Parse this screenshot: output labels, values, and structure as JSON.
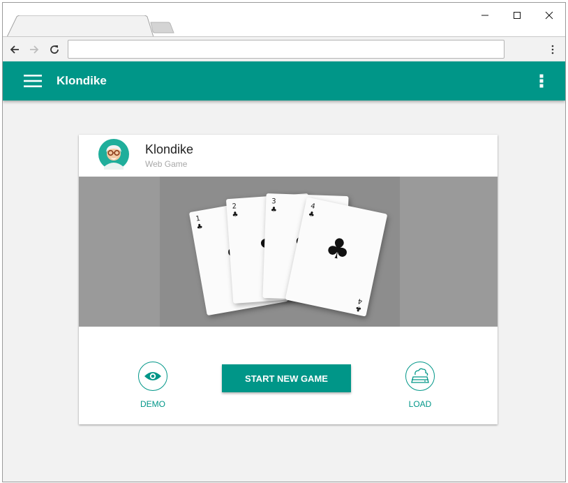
{
  "browser": {
    "tab_title": "",
    "address": "",
    "window_controls": {
      "minimize": "minimize-icon",
      "maximize": "maximize-icon",
      "close": "close-icon"
    },
    "nav_icons": {
      "back": "back-arrow-icon",
      "forward": "forward-arrow-icon",
      "reload": "reload-icon",
      "menu": "more-vert-icon"
    }
  },
  "appbar": {
    "title": "Klondike",
    "color": "#009688",
    "menu_icon": "hamburger-menu-icon",
    "more_icon": "more-vert-icon"
  },
  "card": {
    "title": "Klondike",
    "subtitle": "Web Game",
    "avatar": "avatar-old-man-glasses",
    "media": {
      "cards": [
        {
          "rank": "1",
          "suit": "♣"
        },
        {
          "rank": "2",
          "suit": "♣"
        },
        {
          "rank": "3",
          "suit": "♣"
        },
        {
          "rank": "4",
          "suit": "♣"
        }
      ]
    },
    "actions": {
      "demo_label": "DEMO",
      "demo_icon": "eye-icon",
      "start_label": "START NEW GAME",
      "load_label": "LOAD",
      "load_icon": "cloud-drive-icon"
    }
  },
  "colors": {
    "accent": "#009688",
    "background": "#f2f2f2",
    "media_bg": "#9a9a9a"
  }
}
